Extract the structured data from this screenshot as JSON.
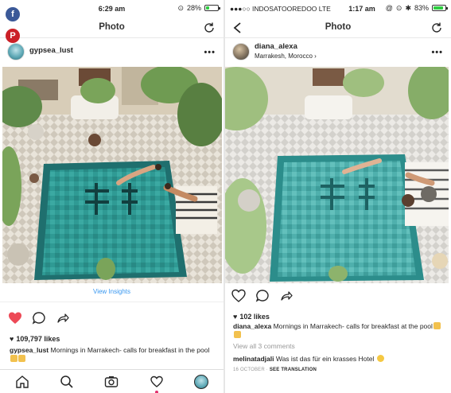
{
  "left_phone": {
    "status": {
      "time": "6:29 am",
      "battery_percent": "28%",
      "battery_level": 0.28
    },
    "nav": {
      "title": "Photo"
    },
    "post": {
      "username": "gypsea_lust",
      "view_insights": "View Insights",
      "likes": "109,797 likes",
      "caption_user": "gypsea_lust",
      "caption_text": "Mornings in Marrakech- calls for breakfast in the pool"
    },
    "tabs": [
      "home",
      "search",
      "camera",
      "activity",
      "profile"
    ]
  },
  "right_phone": {
    "status": {
      "carrier": "●●●○○ INDOSATOOREDOO  LTE",
      "time": "1:17 am",
      "battery_percent": "83%",
      "battery_level": 0.83
    },
    "nav": {
      "title": "Photo"
    },
    "post": {
      "username": "diana_alexa",
      "location": "Marrakesh, Morocco",
      "likes": "102 likes",
      "caption_user": "diana_alexa",
      "caption_text": "Mornings in Marrakech- calls for breakfast at the pool",
      "view_comments": "View all 3 comments",
      "comment_user": "melinatadjali",
      "comment_text": "Was ist das für ein krasses Hotel",
      "date": "16 OCTOBER",
      "see_translation": "SEE TRANSLATION"
    }
  },
  "share_badges": {
    "facebook": "f",
    "pinterest": "P"
  },
  "colors": {
    "like_red": "#ed4956",
    "link_blue": "#3897f0",
    "facebook": "#3b5998",
    "pinterest": "#cb2027",
    "battery_green": "#2ecc40"
  }
}
